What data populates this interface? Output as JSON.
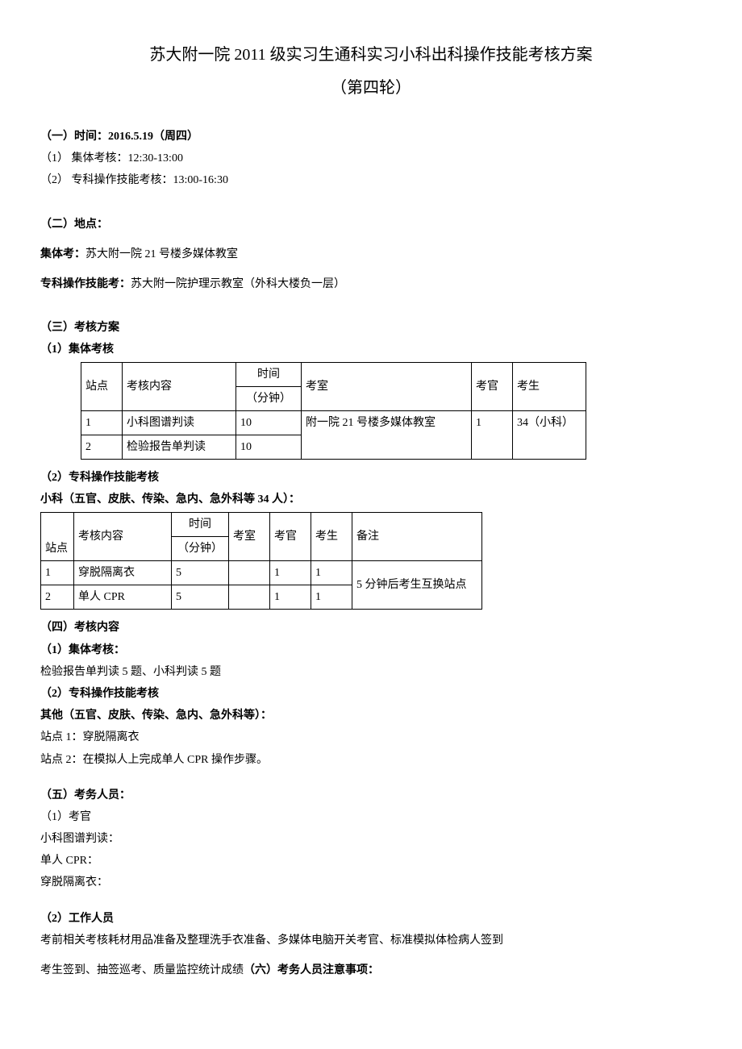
{
  "title": "苏大附一院 2011 级实习生通科实习小科出科操作技能考核方案",
  "subtitle": "（第四轮）",
  "sec1": {
    "heading": "（一）时间：2016.5.19（周四）",
    "item1": "（1）  集体考核：12:30-13:00",
    "item2": "（2）  专科操作技能考核：13:00-16:30"
  },
  "sec2": {
    "heading": "（二）地点：",
    "label1": "集体考：",
    "text1": "苏大附一院 21 号楼多媒体教室",
    "label2": "专科操作技能考：",
    "text2": "苏大附一院护理示教室（外科大楼负一层）"
  },
  "sec3": {
    "heading": "（三）考核方案",
    "sub1": "（1）集体考核",
    "table1": {
      "headers": {
        "station": "站点",
        "content": "考核内容",
        "time1": "时间",
        "time2": "（分钟）",
        "room": "考室",
        "examiner": "考官",
        "student": "考生"
      },
      "rows": [
        {
          "station": "1",
          "content": "小科图谱判读",
          "time": "10",
          "room": "附一院 21 号楼多媒体教室",
          "examiner": "1",
          "student": "34（小科）"
        },
        {
          "station": "2",
          "content": "检验报告单判读",
          "time": "10"
        }
      ]
    },
    "sub2": "（2）专科操作技能考核",
    "sub2_desc": "小科（五官、皮肤、传染、急内、急外科等 34 人）：",
    "table2": {
      "headers": {
        "station": "站点",
        "content": "考核内容",
        "time1": "时间",
        "time2": "（分钟）",
        "room": "考室",
        "examiner": "考官",
        "student": "考生",
        "note": "备注"
      },
      "rows": [
        {
          "station": "1",
          "content": "穿脱隔离衣",
          "time": "5",
          "room": "",
          "examiner": "1",
          "student": "1"
        },
        {
          "station": "2",
          "content": "单人 CPR",
          "time": "5",
          "room": "",
          "examiner": "1",
          "student": "1"
        }
      ],
      "note": "5 分钟后考生互换站点"
    }
  },
  "sec4": {
    "heading": "（四）考核内容",
    "sub1": "（1）集体考核：",
    "text1": "检验报告单判读 5 题、小科判读 5 题",
    "sub2": "（2）专科操作技能考核",
    "sub2_desc": "其他（五官、皮肤、传染、急内、急外科等）：",
    "text2a": "站点 1：穿脱隔离衣",
    "text2b": "站点 2：在模拟人上完成单人 CPR 操作步骤。"
  },
  "sec5": {
    "heading": "（五）考务人员：",
    "sub1": "（1）考官",
    "text1": "小科图谱判读：",
    "text2": "单人 CPR：",
    "text3": "穿脱隔离衣：",
    "sub2": "（2）工作人员",
    "text4": "考前相关考核耗材用品准备及整理洗手衣准备、多媒体电脑开关考官、标准模拟体检病人签到",
    "text5a": "考生签到、抽签巡考、质量监控统计成绩",
    "text5b": "（六）考务人员注意事项："
  }
}
